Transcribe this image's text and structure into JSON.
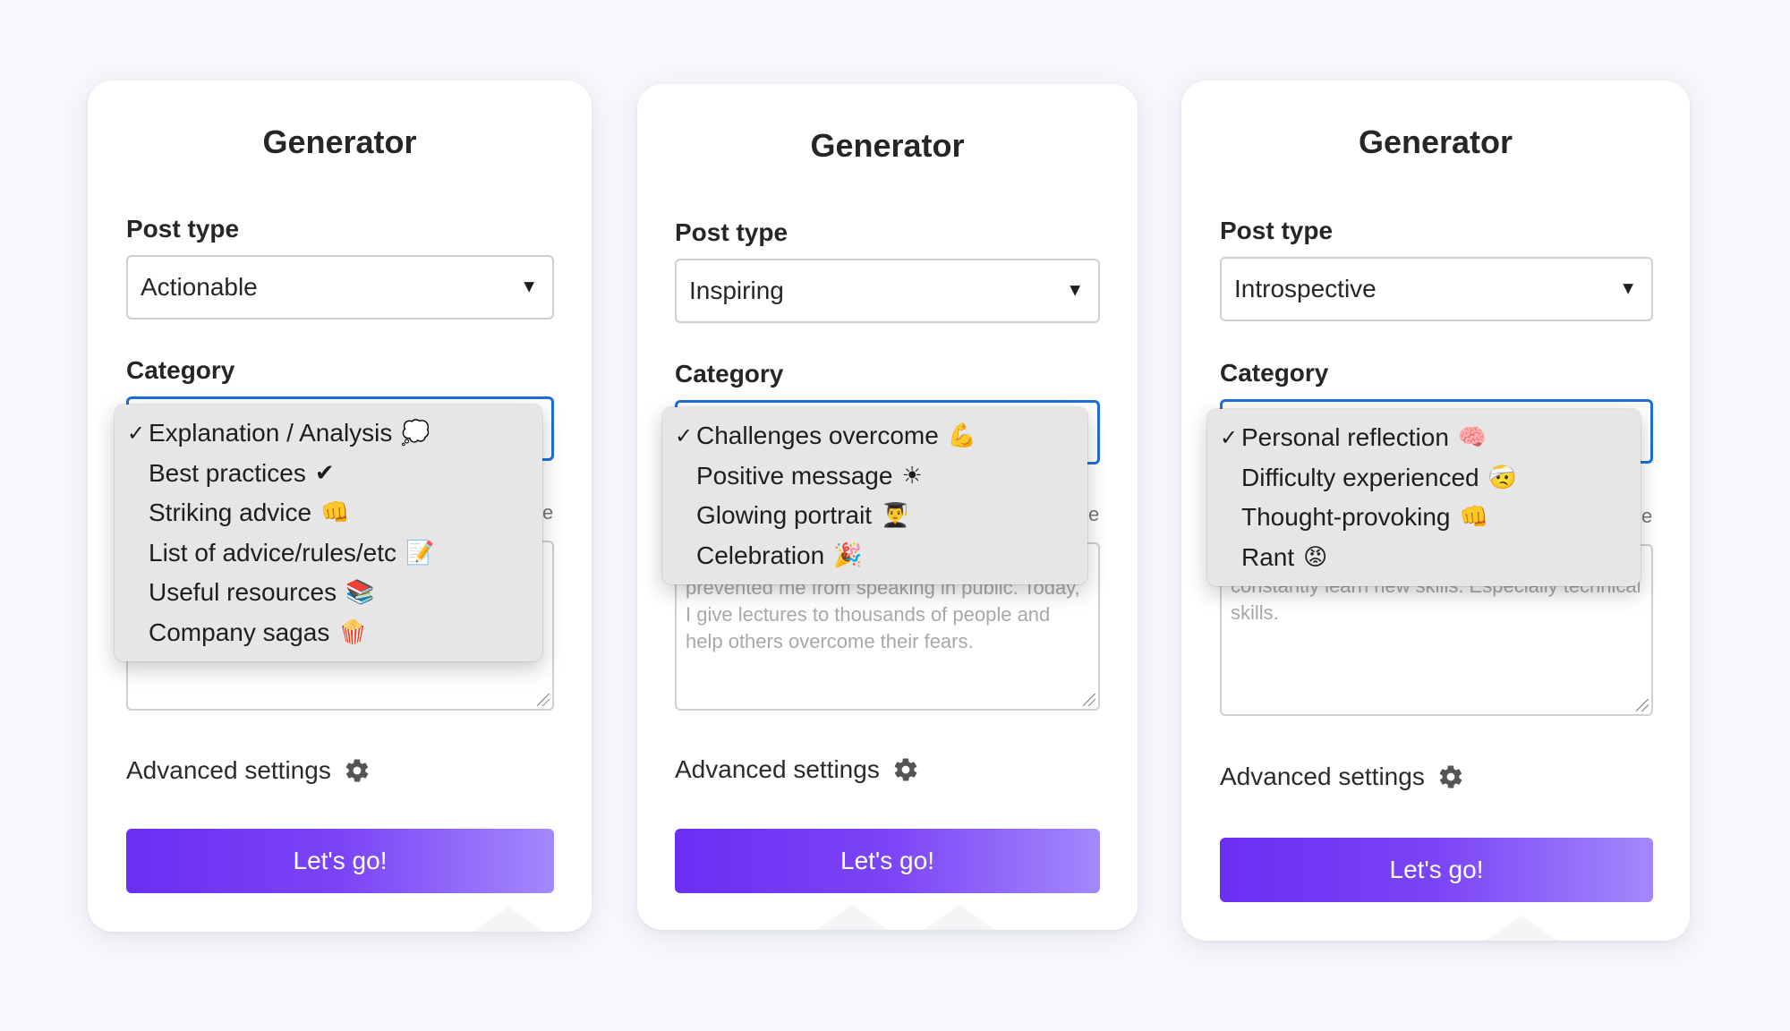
{
  "cards": [
    {
      "title": "Generator",
      "post_type_label": "Post type",
      "post_type_value": "Actionable",
      "category_label": "Category",
      "partial_letter": "e",
      "textarea_text": "",
      "advanced_label": "Advanced settings",
      "button_label": "Let's go!",
      "menu": [
        {
          "label": "Explanation / Analysis",
          "emoji": "💭",
          "checked": "✓"
        },
        {
          "label": "Best practices",
          "emoji": "✔",
          "checked": ""
        },
        {
          "label": "Striking advice",
          "emoji": "👊",
          "checked": ""
        },
        {
          "label": "List of advice/rules/etc",
          "emoji": "📝",
          "checked": ""
        },
        {
          "label": "Useful resources",
          "emoji": "📚",
          "checked": ""
        },
        {
          "label": "Company sagas",
          "emoji": "🍿",
          "checked": ""
        }
      ]
    },
    {
      "title": "Generator",
      "post_type_label": "Post type",
      "post_type_value": "Inspiring",
      "category_label": "Category",
      "partial_letter": "e",
      "textarea_text": "prevented me from speaking in public. Today, I give lectures to thousands of people and help others overcome their fears.",
      "advanced_label": "Advanced settings",
      "button_label": "Let's go!",
      "menu": [
        {
          "label": "Challenges overcome",
          "emoji": "💪",
          "checked": "✓"
        },
        {
          "label": "Positive message",
          "emoji": "☀",
          "checked": ""
        },
        {
          "label": "Glowing portrait",
          "emoji": "👨‍🎓",
          "checked": ""
        },
        {
          "label": "Celebration",
          "emoji": "🎉",
          "checked": ""
        }
      ]
    },
    {
      "title": "Generator",
      "post_type_label": "Post type",
      "post_type_value": "Introspective",
      "category_label": "Category",
      "partial_letter": "e",
      "textarea_text": "constantly learn new skills. Especially technical skills.",
      "advanced_label": "Advanced settings",
      "button_label": "Let's go!",
      "menu": [
        {
          "label": "Personal reflection",
          "emoji": "🧠",
          "checked": "✓"
        },
        {
          "label": "Difficulty experienced",
          "emoji": "🤕",
          "checked": ""
        },
        {
          "label": "Thought-provoking",
          "emoji": "👊",
          "checked": ""
        },
        {
          "label": "Rant",
          "emoji": "😡",
          "checked": ""
        }
      ]
    }
  ],
  "icons": {
    "dropdown_caret": "▼",
    "settings": "gear-icon",
    "check": "check-icon"
  },
  "colors": {
    "button_start": "#6a2ff2",
    "button_end": "#a389fb",
    "focus_border": "#1d6fd8",
    "menu_bg": "#e6e6e6"
  }
}
